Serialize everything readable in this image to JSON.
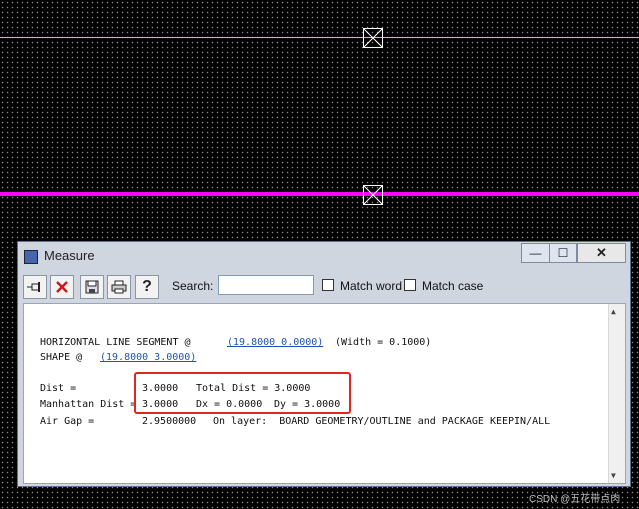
{
  "canvas": {
    "colors": {
      "background": "#000000",
      "grid_dots": "#8a8a8a",
      "line_1": "#d6d600",
      "line_2": "#ff00ff",
      "marker": "#ffffff"
    }
  },
  "window": {
    "title": "Measure",
    "controls": {
      "minimize": "—",
      "maximize": "☐",
      "close": "✕"
    },
    "toolbar": {
      "icons": [
        "pin-icon",
        "delete-icon",
        "save-icon",
        "print-icon",
        "help-icon"
      ],
      "search_label": "Search:",
      "search_value": "",
      "match_word_label": "Match word",
      "match_case_label": "Match case"
    },
    "output": {
      "line1_label": "HORIZONTAL LINE SEGMENT @",
      "line1_link": "(19.8000 0.0000)",
      "line1_suffix": "(Width = 0.1000)",
      "line2_label": "SHAPE @",
      "line2_link": "(19.8000 3.0000)",
      "dist_label": "Dist =",
      "dist_value": "3.0000",
      "total_dist": "Total Dist = 3.0000",
      "manhattan_label": "Manhattan Dist =",
      "manhattan_value": "3.0000",
      "dx": "Dx = 0.0000",
      "dy": "Dy = 3.0000",
      "airgap_label": "Air Gap =",
      "airgap_value": "2.9500000",
      "layer": "On layer:  BOARD GEOMETRY/OUTLINE and PACKAGE KEEPIN/ALL"
    }
  },
  "watermark": "CSDN @五花带点肉"
}
